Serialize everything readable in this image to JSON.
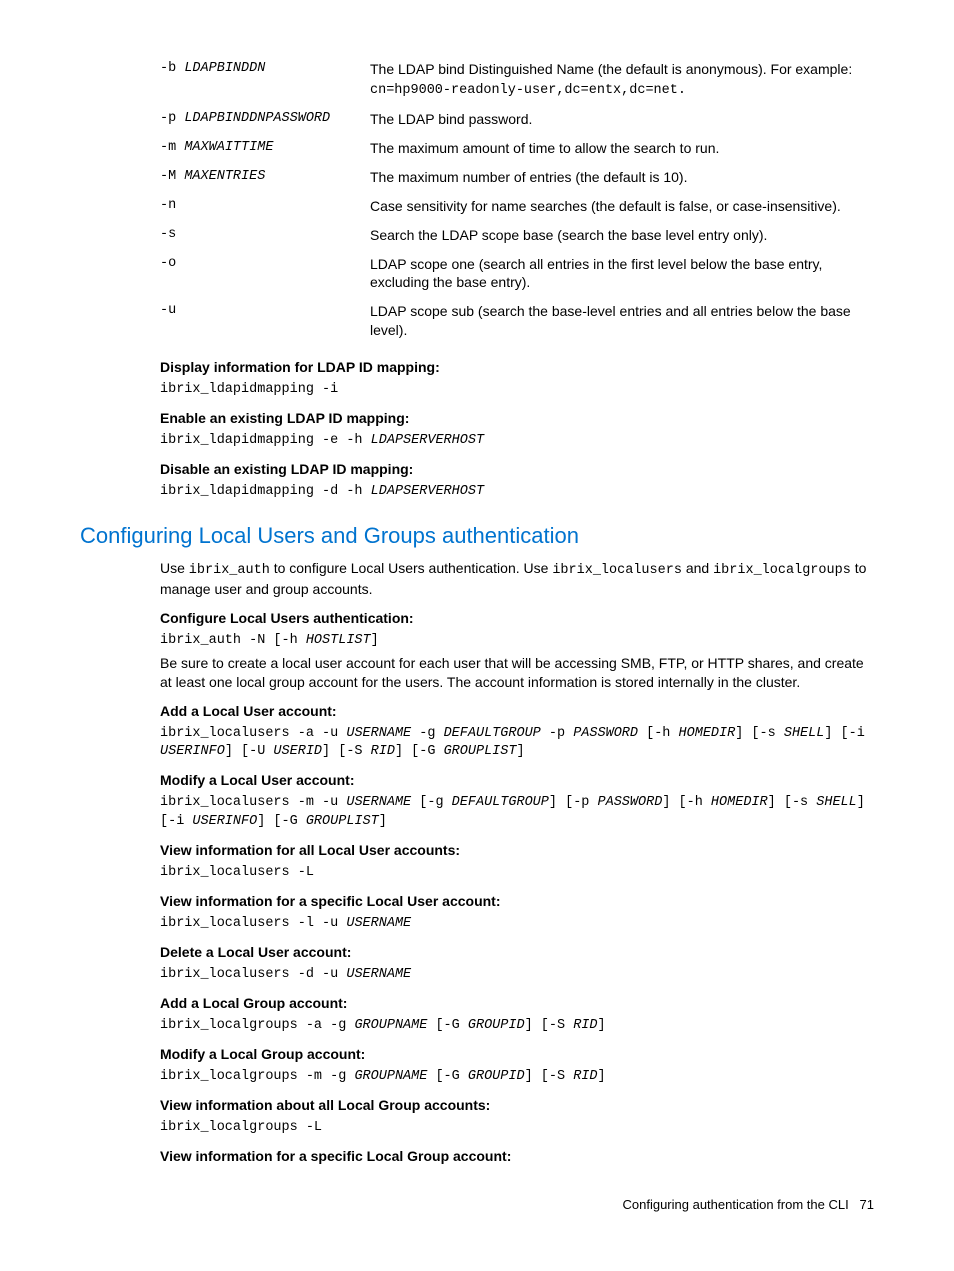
{
  "options": [
    {
      "flag": "-b",
      "arg": "LDAPBINDDN",
      "desc_pre": "The LDAP bind Distinguished Name (the default is anonymous). For example: ",
      "desc_mono": "cn=hp9000-readonly-user,dc=entx,dc=net.",
      "desc_post": ""
    },
    {
      "flag": "-p",
      "arg": "LDAPBINDDNPASSWORD",
      "desc_pre": "The LDAP bind password.",
      "desc_mono": "",
      "desc_post": ""
    },
    {
      "flag": "-m",
      "arg": "MAXWAITTIME",
      "desc_pre": "The maximum amount of time to allow the search to run.",
      "desc_mono": "",
      "desc_post": ""
    },
    {
      "flag": "-M",
      "arg": "MAXENTRIES",
      "desc_pre": "The maximum number of entries (the default is 10).",
      "desc_mono": "",
      "desc_post": ""
    },
    {
      "flag": "-n",
      "arg": "",
      "desc_pre": "Case sensitivity for name searches (the default is false, or case-insensitive).",
      "desc_mono": "",
      "desc_post": ""
    },
    {
      "flag": "-s",
      "arg": "",
      "desc_pre": "Search the LDAP scope base (search the base level entry only).",
      "desc_mono": "",
      "desc_post": ""
    },
    {
      "flag": "-o",
      "arg": "",
      "desc_pre": "LDAP scope one (search all entries in the first level below the base entry, excluding the base entry).",
      "desc_mono": "",
      "desc_post": ""
    },
    {
      "flag": "-u",
      "arg": "",
      "desc_pre": "LDAP scope sub (search the base-level entries and all entries below the base level).",
      "desc_mono": "",
      "desc_post": ""
    }
  ],
  "ldap": {
    "display_h": "Display information for LDAP ID mapping:",
    "display_c": "ibrix_ldapidmapping -i",
    "enable_h": "Enable an existing LDAP ID mapping:",
    "enable_c_pre": "ibrix_ldapidmapping -e -h ",
    "enable_c_arg": "LDAPSERVERHOST",
    "disable_h": "Disable an existing LDAP ID mapping:",
    "disable_c_pre": "ibrix_ldapidmapping -d -h ",
    "disable_c_arg": "LDAPSERVERHOST"
  },
  "section_title": "Configuring Local Users and Groups authentication",
  "intro": {
    "t1": "Use ",
    "m1": "ibrix_auth",
    "t2": " to configure Local Users authentication. Use ",
    "m2": "ibrix_localusers",
    "t3": " and ",
    "m3": "ibrix_localgroups",
    "t4": " to manage user and group accounts."
  },
  "cfg": {
    "h": "Configure Local Users authentication:",
    "c_pre": "ibrix_auth -N  [-h ",
    "c_arg": "HOSTLIST",
    "c_post": "]",
    "note": "Be sure to create a local user account for each user that will be accessing SMB, FTP, or HTTP shares, and create at least one local group account for the users. The account information is stored internally in the cluster."
  },
  "addlu": {
    "h": "Add a Local User account:",
    "p": [
      "ibrix_localusers -a -u ",
      "USERNAME",
      " -g ",
      "DEFAULTGROUP",
      " -p ",
      "PASSWORD",
      " [-h ",
      "HOMEDIR",
      "] [-s ",
      "SHELL",
      "] [-i ",
      "USERINFO",
      "] [-U ",
      "USERID",
      "] [-S ",
      "RID",
      "] [-G ",
      "GROUPLIST",
      "]"
    ]
  },
  "modlu": {
    "h": "Modify a Local User account:",
    "p": [
      "ibrix_localusers -m -u ",
      "USERNAME",
      " [-g ",
      "DEFAULTGROUP",
      "]  [-p ",
      "PASSWORD",
      "]  [-h ",
      "HOMEDIR",
      "] [-s ",
      "SHELL",
      "] [-i ",
      "USERINFO",
      "] [-G ",
      "GROUPLIST",
      "]"
    ]
  },
  "viewall_lu": {
    "h": "View information for all Local User accounts:",
    "c": "ibrix_localusers -L"
  },
  "viewone_lu": {
    "h": "View information for a specific Local User account:",
    "c_pre": "ibrix_localusers -l -u ",
    "c_arg": "USERNAME"
  },
  "del_lu": {
    "h": "Delete a Local User account:",
    "c_pre": "ibrix_localusers -d -u ",
    "c_arg": "USERNAME"
  },
  "addlg": {
    "h": "Add a Local Group account:",
    "p": [
      "ibrix_localgroups -a -g ",
      "GROUPNAME",
      " [-G ",
      "GROUPID",
      "] [-S ",
      "RID",
      "]"
    ]
  },
  "modlg": {
    "h": "Modify a Local Group account:",
    "p": [
      "ibrix_localgroups -m -g ",
      "GROUPNAME",
      " [-G ",
      "GROUPID",
      "] [-S ",
      "RID",
      "]"
    ]
  },
  "viewall_lg": {
    "h": "View information about all Local Group accounts:",
    "c": "ibrix_localgroups -L"
  },
  "viewone_lg": {
    "h": "View information for a specific Local Group account:"
  },
  "footer": {
    "text": "Configuring authentication from the CLI",
    "page": "71"
  }
}
